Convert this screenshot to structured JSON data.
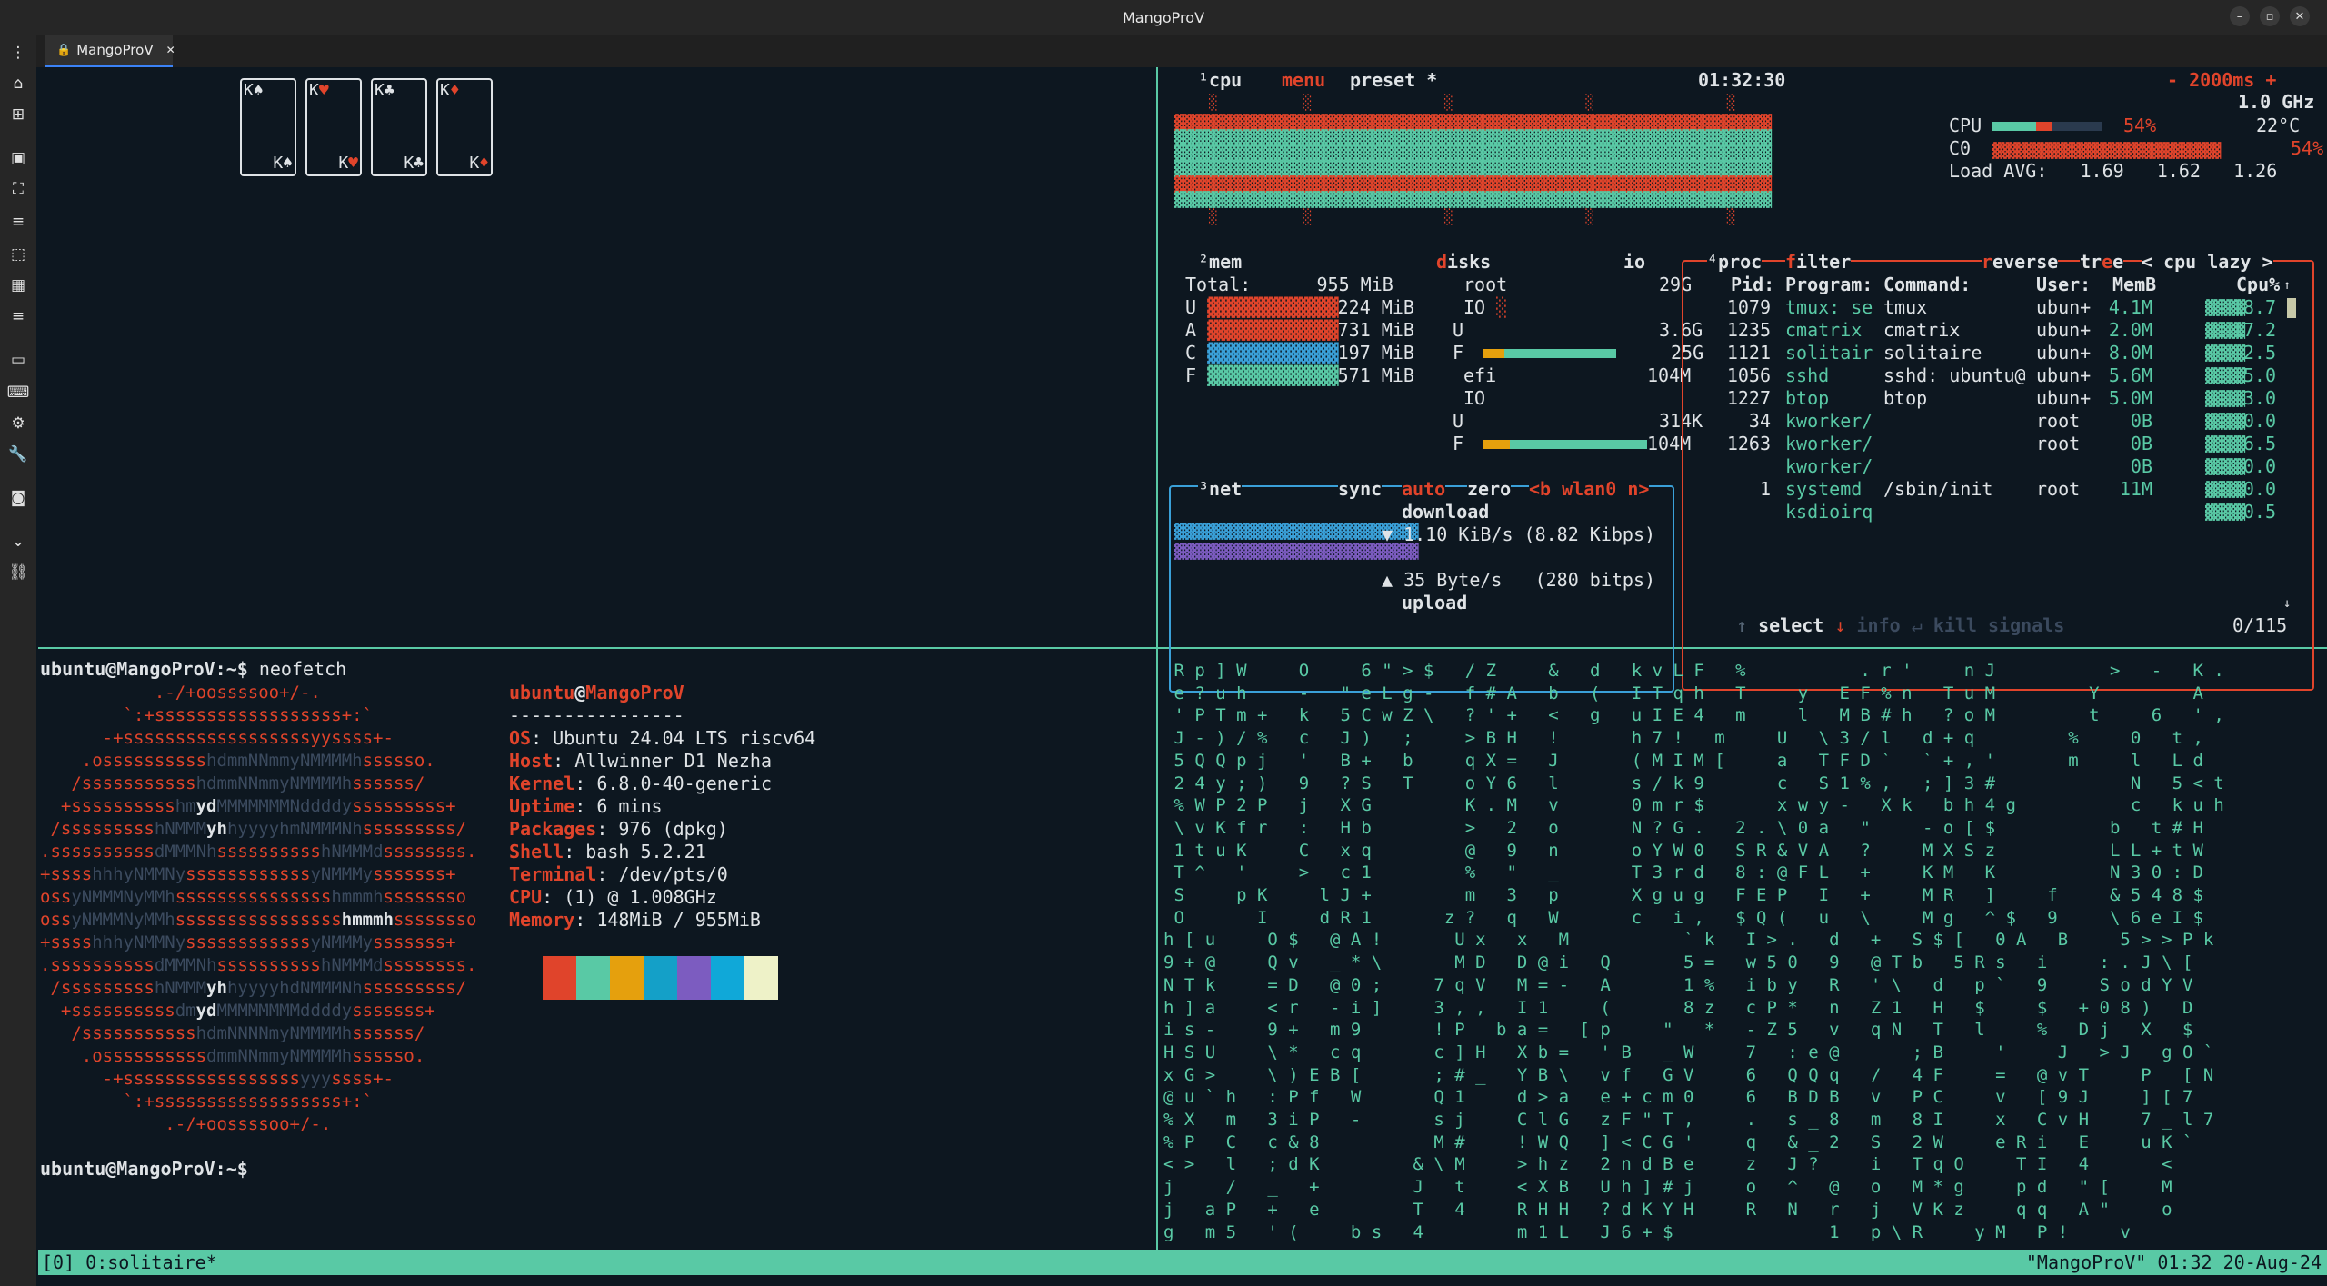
{
  "window": {
    "title": "MangoProV",
    "minimize": "–",
    "maximize": "▫",
    "close": "✕"
  },
  "tab": {
    "label": "MangoProV",
    "close": "✕"
  },
  "solitaire": {
    "cards": [
      {
        "rank": "K",
        "suit": "♠",
        "color": "white"
      },
      {
        "rank": "K",
        "suit": "♥",
        "color": "red"
      },
      {
        "rank": "K",
        "suit": "♣",
        "color": "white"
      },
      {
        "rank": "K",
        "suit": "♦",
        "color": "red"
      }
    ]
  },
  "btop": {
    "cpu_header": {
      "num": "¹",
      "cpu": "cpu",
      "menu": "menu",
      "preset": "preset *",
      "time": "01:32:30",
      "interval": "- 2000ms +",
      "freq": "1.0 GHz"
    },
    "cpu_stats": {
      "cpu_label": "CPU",
      "cpu_pct": "54%",
      "temp": "22°C",
      "c0_label": "C0",
      "c0_pct": "54%",
      "load_label": "Load AVG:",
      "load1": "1.69",
      "load5": "1.62",
      "load15": "1.26"
    },
    "mem": {
      "title": "mem",
      "num": "²",
      "disks_title": "disks",
      "io_title": "io",
      "total_label": "Total:",
      "total": "955 MiB",
      "rows": [
        {
          "label": "U",
          "value": "224 MiB"
        },
        {
          "label": "A",
          "value": "731 MiB"
        },
        {
          "label": "C",
          "value": "197 MiB"
        },
        {
          "label": "F",
          "value": "571 MiB"
        }
      ],
      "disks": {
        "root": "root",
        "root_size": "29G",
        "io": "IO",
        "u_label": "U",
        "u_value": "3.6G",
        "f_label": "F",
        "f_value": "25G",
        "efi": "efi",
        "efi_size": "104M",
        "io2": "IO",
        "u2_value": "314K",
        "f2_value": "104M"
      }
    },
    "net": {
      "num": "³",
      "title": "net",
      "sync": "sync",
      "auto": "auto",
      "zero": "zero",
      "iface": "<b wlan0 n>",
      "download_label": "download",
      "down_rate": "▼ 1.10 KiB/s (8.82 Kibps)",
      "up_rate": "▲ 35 Byte/s   (280 bitps)",
      "upload_label": "upload"
    },
    "proc": {
      "num": "⁴",
      "title": "proc",
      "filter": "filter",
      "reverse": "reverse",
      "tree": "tree",
      "sort": "< cpu lazy >",
      "headers": {
        "pid": "Pid:",
        "program": "Program:",
        "command": "Command:",
        "user": "User:",
        "mem": "MemB",
        "cpu": "Cpu%"
      },
      "rows": [
        {
          "pid": "1079",
          "program": "tmux: se",
          "command": "tmux",
          "user": "ubun+",
          "mem": "4.1M",
          "cpu": "18.7"
        },
        {
          "pid": "1235",
          "program": "cmatrix",
          "command": "cmatrix",
          "user": "ubun+",
          "mem": "2.0M",
          "cpu": "17.2"
        },
        {
          "pid": "1121",
          "program": "solitair",
          "command": "solitaire",
          "user": "ubun+",
          "mem": "8.0M",
          "cpu": "2.5"
        },
        {
          "pid": "1056",
          "program": "sshd",
          "command": "sshd: ubuntu@",
          "user": "ubun+",
          "mem": "5.6M",
          "cpu": "5.0"
        },
        {
          "pid": "1227",
          "program": "btop",
          "command": "btop",
          "user": "ubun+",
          "mem": "5.0M",
          "cpu": "3.0"
        },
        {
          "pid": "34",
          "program": "kworker/",
          "command": "",
          "user": "root",
          "mem": "0B",
          "cpu": "0.0"
        },
        {
          "pid": "1263",
          "program": "kworker/",
          "command": "",
          "user": "root",
          "mem": "0B",
          "cpu": "6.5"
        },
        {
          "pid": "",
          "program": "kworker/",
          "command": "",
          "user": "",
          "mem": "0B",
          "cpu": "0.0"
        },
        {
          "pid": "1",
          "program": "systemd",
          "command": "/sbin/init",
          "user": "root",
          "mem": "11M",
          "cpu": "0.0"
        },
        {
          "pid": "",
          "program": "ksdioirq",
          "command": "",
          "user": "",
          "mem": "",
          "cpu": "0.5"
        }
      ],
      "footer_select": "select",
      "footer_info": "info",
      "footer_kill": "kill",
      "footer_signals": "signals",
      "count": "0/115"
    }
  },
  "neofetch": {
    "prompt": "ubuntu@MangoProV:~$ ",
    "command": "neofetch",
    "user": "ubuntu",
    "at": "@",
    "host": "MangoProV",
    "separator": "----------------",
    "info": [
      {
        "key": "OS",
        "value": ": Ubuntu 24.04 LTS riscv64"
      },
      {
        "key": "Host",
        "value": ": Allwinner D1 Nezha"
      },
      {
        "key": "Kernel",
        "value": ": 6.8.0-40-generic"
      },
      {
        "key": "Uptime",
        "value": ": 6 mins"
      },
      {
        "key": "Packages",
        "value": ": 976 (dpkg)"
      },
      {
        "key": "Shell",
        "value": ": bash 5.2.21"
      },
      {
        "key": "Terminal",
        "value": ": /dev/pts/0"
      },
      {
        "key": "CPU",
        "value": ": (1) @ 1.008GHz"
      },
      {
        "key": "Memory",
        "value": ": 148MiB / 955MiB"
      }
    ],
    "palette": [
      "#e0442b",
      "#59c9a5",
      "#e5a00d",
      "#14a0c8",
      "#7c5cc0",
      "#10a8d8",
      "#eef2c8"
    ],
    "prompt_end": "ubuntu@MangoProV:~$ "
  },
  "matrix": {
    "lines": [
      " R p ] W     O     6 \" > $   / Z     &   d   k v L F   %           . r '     n J           >   -   K .",
      " e ? u h     -   \" e L g -   f # A   b   (   I T q h   T     y   E F % n   T u M         Y         A",
      " ' P T m +   k   5 C w Z \\   ? ' +   <   g   u I E 4   m     l   M B # h   ? o M         t     6   ' ,",
      " J - ) / %   c   J )   ;     > B H   !       h 7 !   m     U   \\ 3 / l   d + q         %     0   t ,",
      " 5 Q Q p j   '   B +   b     q X =   J       ( M I M [     a   T F D `   ` + , '       m     l   L d",
      " 2 4 y ; )   9   ? S   T     o Y 6   l       s / k 9       c   S 1 % ,   ; ] 3 #             N   5 < t",
      " % W P 2 P   j   X G         K . M   v       0 m r $       x w y -   X k   b h 4 g           c   k u h",
      " \\ v K f r   :   H b         >   2   o       N ? G .   2 . \\ 0 a   \"     - o [ $           b   t # H",
      " 1 t u K     C   x q         @   9   n       o Y W 0   S R & V A   ?     M X S z           L L + t W",
      " T ^   '     >   c 1         %   \"   _       T 3 r d   8 : @ F L   +     K M   K           N 3 0 : D",
      " S     p K     l J +         m   3   p       X g u g   F E P   I   +     M R   ]     f     & 5 4 8 $",
      " O       I     d R 1       z ?   q   W       c   i ,   $ Q (   u   \\     M g   ^ $   9     \\ 6 e I $",
      "h [ u     O $   @ A !       U x   x   M           ` k   I > .   d   +   S $ [   0 A   B     5 > > P k",
      "9 + @     Q v   _ * \\       M D   D @ i   Q       5 =   w 5 0   9   @ T b   5 R s   i     : . J \\ [",
      "N T k     = D   @ 0 ;     7 q V   M = -   A       1 %   i b y   R   ' \\   d   p `   9     S o d Y V",
      "h ] a     < r   - i ]     3 , ,   I 1     (       8 z   c P *   n   Z 1   H   $     $   + 0 8 )   D",
      "i s -     9 +   m 9       ! P   b a =   [ p     \"   *   - Z 5   v   q N   T   l     %   D j   X   $",
      "H S U     \\ *   c q       c ] H   X b =   ' B   _ W     7   : e @       ; B     '     J   > J   g O `",
      "x G >     \\ ) E B [       ; # _   Y B \\   v f   G V     6   Q Q q   /   4 F     =   @ v T     P   [ N",
      "@ u ` h   : P f   W       Q 1     d > a   e + c m 0     6   B D B   v   P C     v   [ 9 J     ] [ 7",
      "% X   m   3 i P   -       s j     C l G   z F \" T ,     .   s _ 8   m   8 I     x   C v H     7 _ l 7",
      "% P   C   c & 8           M #     ! W Q   ] < C G '     q   & _ 2   S   2 W     e R i   E     u K `",
      "< >   l   ; d K         & \\ M     > h z   2 n d B e     z   J ?     i   T q O     T I   4       <",
      "j     /   _   +         J   t     < X B   U h ] # j     o   ^   @   o   M * g     p d   \" [     M",
      "j   a P   +   e         T   4     R H H   ? d K Y H     R   N   r   j   V K z     q q   A \"     o",
      "g   m 5   ' (     b s   4         m 1 L   J 6 + $               1   p \\ R     y M   P !     v"
    ]
  },
  "status": {
    "left": "[0] 0:solitaire*",
    "right": "\"MangoProV\" 01:32 20-Aug-24"
  }
}
